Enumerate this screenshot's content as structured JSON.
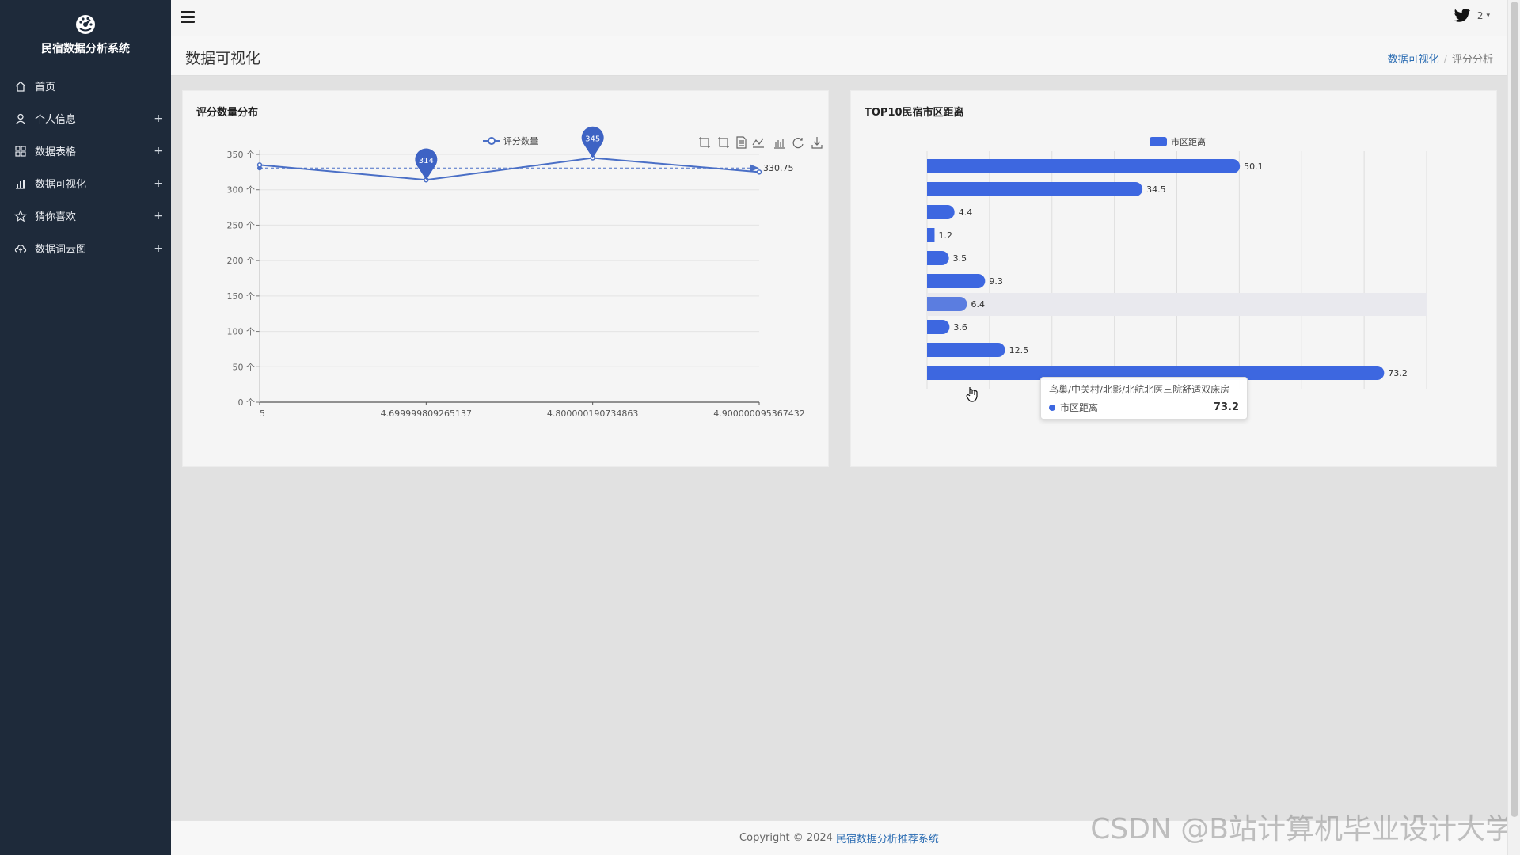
{
  "brand": {
    "title": "民宿数据分析系统"
  },
  "sidebar": {
    "items": [
      {
        "label": "首页",
        "icon": "home-icon",
        "expandable": false
      },
      {
        "label": "个人信息",
        "icon": "user-icon",
        "expandable": true
      },
      {
        "label": "数据表格",
        "icon": "grid-icon",
        "expandable": true
      },
      {
        "label": "数据可视化",
        "icon": "bar-chart-icon",
        "expandable": true
      },
      {
        "label": "猜你喜欢",
        "icon": "star-icon",
        "expandable": true
      },
      {
        "label": "数据词云图",
        "icon": "cloud-icon",
        "expandable": true
      }
    ],
    "plus": "+"
  },
  "header": {
    "user_label": "2",
    "caret": "▾"
  },
  "page": {
    "title": "数据可视化",
    "breadcrumb": {
      "link": "数据可视化",
      "sep": "/",
      "current": "评分分析"
    }
  },
  "charts": {
    "left_title": "评分数量分布",
    "right_title": "TOP10民宿市区距离"
  },
  "chart_data": [
    {
      "type": "line",
      "title": "评分数量分布",
      "series": [
        {
          "name": "评分数量",
          "values": [
            335,
            314,
            345,
            325
          ]
        }
      ],
      "x": [
        "5",
        "4.699999809265137",
        "4.800000190734863",
        "4.900000095367432"
      ],
      "ylim": [
        0,
        350
      ],
      "yticks": [
        0,
        50,
        100,
        150,
        200,
        250,
        300,
        350
      ],
      "ytick_suffix": " 个",
      "markpoints": [
        314,
        345
      ],
      "markline": {
        "value": 330.75,
        "label": "330.75"
      },
      "legend": "top-center",
      "grid": true
    },
    {
      "type": "bar",
      "orientation": "horizontal",
      "title": "TOP10民宿市区距离",
      "series": [
        {
          "name": "市区距离",
          "values": [
            50.1,
            34.5,
            4.4,
            1.2,
            3.5,
            9.3,
            6.4,
            3.6,
            12.5,
            73.2
          ]
        }
      ],
      "xlim": [
        0,
        80
      ],
      "legend": "top-center",
      "grid": true,
      "highlight_index": 6
    }
  ],
  "tooltip": {
    "title": "鸟巢/中关村/北影/北航北医三院舒适双床房",
    "series": "市区距离",
    "value": "73.2"
  },
  "footer": {
    "text": "Copyright © 2024",
    "link": "民宿数据分析推荐系统"
  },
  "watermark": "CSDN @B站计算机毕业设计大学",
  "colors": {
    "sidebar_bg": "#1e2a3a",
    "line": "#4a6fc6",
    "bar": "#3d67e0",
    "link": "#2c6db3"
  }
}
